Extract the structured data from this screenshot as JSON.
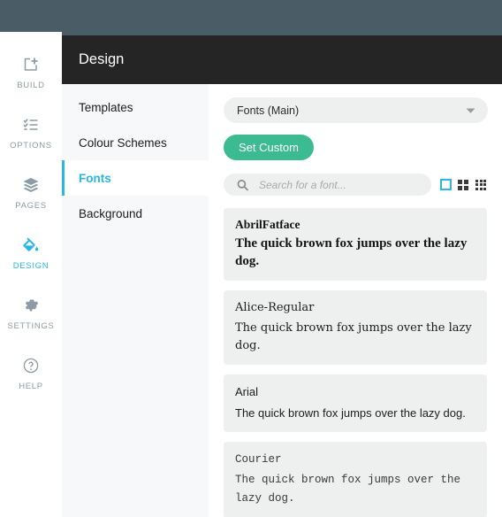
{
  "theme": {
    "topbar_color": "#4a5c66",
    "header_color": "#252525",
    "accent_color": "#29b6e8",
    "button_color": "#3cba92",
    "submenu_bg": "#f7f8f9",
    "card_bg": "#eeefef"
  },
  "rail": {
    "items": [
      {
        "label": "BUILD",
        "icon": "add-box-icon",
        "active": false
      },
      {
        "label": "OPTIONS",
        "icon": "checklist-icon",
        "active": false
      },
      {
        "label": "PAGES",
        "icon": "layers-icon",
        "active": false
      },
      {
        "label": "DESIGN",
        "icon": "paint-bucket-icon",
        "active": true
      },
      {
        "label": "SETTINGS",
        "icon": "gear-icon",
        "active": false
      },
      {
        "label": "HELP",
        "icon": "question-circle-icon",
        "active": false
      }
    ]
  },
  "header": {
    "title": "Design"
  },
  "submenu": {
    "items": [
      {
        "label": "Templates",
        "active": false
      },
      {
        "label": "Colour Schemes",
        "active": false
      },
      {
        "label": "Fonts",
        "active": true
      },
      {
        "label": "Background",
        "active": false
      }
    ]
  },
  "content": {
    "font_group_select": {
      "value": "Fonts (Main)",
      "caret_icon": "chevron-down-icon"
    },
    "set_custom_button": "Set Custom",
    "search": {
      "value": "",
      "placeholder": "Search for a font...",
      "icon": "search-icon"
    },
    "view_toggles": [
      {
        "icon": "single-view-icon",
        "active": true
      },
      {
        "icon": "grid-2x2-icon",
        "active": false
      },
      {
        "icon": "grid-3x3-icon",
        "active": false
      }
    ],
    "fonts": [
      {
        "name": "AbrilFatface",
        "sample": "The quick brown fox jumps over the lazy dog."
      },
      {
        "name": "Alice-Regular",
        "sample": "The quick brown fox jumps over the lazy dog."
      },
      {
        "name": "Arial",
        "sample": "The quick brown fox jumps over the lazy dog."
      },
      {
        "name": "Courier",
        "sample": "The quick brown fox jumps over the lazy dog."
      }
    ]
  }
}
